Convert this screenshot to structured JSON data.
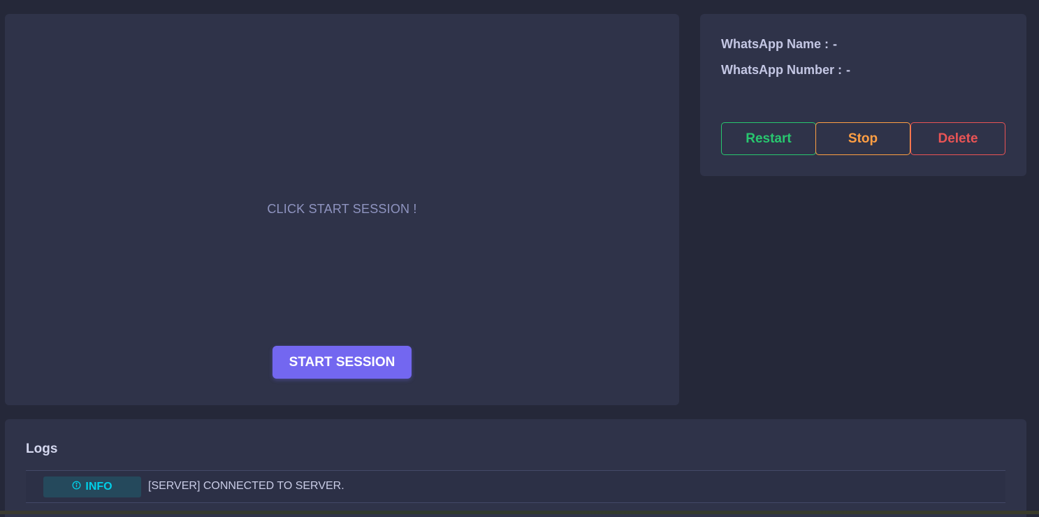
{
  "session": {
    "message": "CLICK START SESSION !",
    "start_label": "START SESSION"
  },
  "info": {
    "name_label": "WhatsApp Name :",
    "name_value": "-",
    "number_label": "WhatsApp Number :",
    "number_value": "-",
    "restart_label": "Restart",
    "stop_label": "Stop",
    "delete_label": "Delete"
  },
  "logs": {
    "title": "Logs",
    "entries": [
      {
        "level": "INFO",
        "icon": "info-circle-icon",
        "message": "[SERVER] CONNECTED TO SERVER."
      }
    ]
  },
  "colors": {
    "primary": "#7367f0",
    "success": "#28c76f",
    "warning": "#ff9f43",
    "danger": "#ea5455",
    "info": "#00cfe8"
  }
}
